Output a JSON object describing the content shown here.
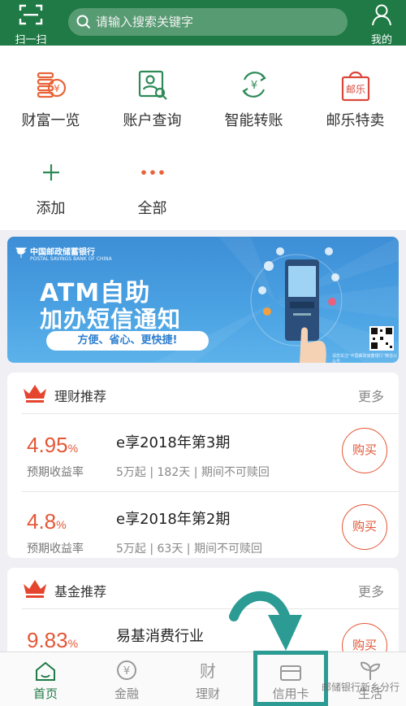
{
  "header": {
    "scan_label": "扫一扫",
    "search_placeholder": "请输入搜索关键字",
    "mine_label": "我的",
    "bg_color": "#1f7a45"
  },
  "quick": {
    "items": [
      {
        "label": "财富一览",
        "icon": "wealth-icon"
      },
      {
        "label": "账户查询",
        "icon": "account-query-icon"
      },
      {
        "label": "智能转账",
        "icon": "transfer-icon"
      },
      {
        "label": "邮乐特卖",
        "icon": "youle-bag-icon"
      },
      {
        "label": "添加",
        "icon": "plus-icon"
      },
      {
        "label": "全部",
        "icon": "more-dots-icon"
      }
    ],
    "youle_icon_text": "邮乐"
  },
  "banner": {
    "bank_name": "中国邮政储蓄银行",
    "bank_name_en": "POSTAL SAVINGS BANK OF CHINA",
    "title_line1": "ATM自助",
    "title_line2": "加办短信通知",
    "slogan": "方便、省心、更快捷!",
    "qr_note": "请您关注“中国邮政储蓄银行”微信公众号"
  },
  "wealth_card": {
    "title": "理财推荐",
    "more": "更多",
    "products": [
      {
        "rate": "4.95",
        "unit": "%",
        "rate_label": "预期收益率",
        "name": "e享2018年第3期",
        "detail": "5万起 | 182天 | 期间不可赎回",
        "action": "购买"
      },
      {
        "rate": "4.8",
        "unit": "%",
        "rate_label": "预期收益率",
        "name": "e享2018年第2期",
        "detail": "5万起 | 63天 | 期间不可赎回",
        "action": "购买"
      }
    ]
  },
  "fund_card": {
    "title": "基金推荐",
    "more": "更多",
    "products": [
      {
        "rate": "9.83",
        "unit": "%",
        "name": "易基消费行业",
        "action": "购买"
      }
    ]
  },
  "tabbar": {
    "tabs": [
      {
        "label": "首页",
        "icon": "home-icon",
        "active": true
      },
      {
        "label": "金融",
        "icon": "finance-yen-icon",
        "active": false
      },
      {
        "label": "理财",
        "icon": "wealth-management-icon",
        "active": false
      },
      {
        "label": "信用卡",
        "icon": "credit-card-icon",
        "active": false
      },
      {
        "label": "生活",
        "icon": "life-sprout-icon",
        "active": false
      }
    ],
    "icon_glyph_licai": "财"
  },
  "watermark": "邮储银行新乡分行",
  "colors": {
    "accent": "#e35736",
    "brand": "#1f7a45",
    "highlight": "#2b9b93"
  }
}
